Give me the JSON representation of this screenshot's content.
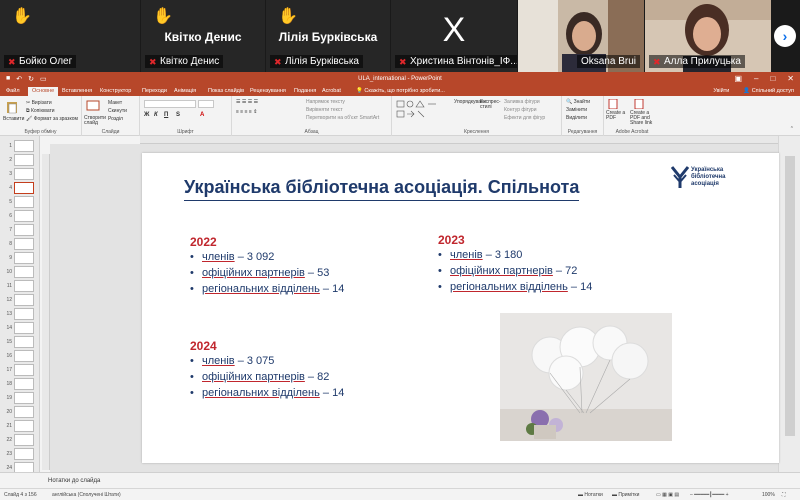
{
  "participants": [
    {
      "id": "boyko",
      "name": "Бойко Олег",
      "hand": true,
      "muted": true,
      "label": "Бойко Олег"
    },
    {
      "id": "kvitko",
      "name": "Квітко Денис",
      "hand": true,
      "muted": true,
      "label": "Квітко Денис"
    },
    {
      "id": "burkivska",
      "name": "Лілія Бурківська",
      "hand": true,
      "muted": true,
      "label": "Лілія Бурківська"
    },
    {
      "id": "vintoniv",
      "initial": "X",
      "muted": true,
      "label": "Христина Вінтонів_ІФ..."
    },
    {
      "id": "brui",
      "muted": false,
      "label": "Oksana Brui"
    },
    {
      "id": "prylutska",
      "muted": true,
      "label": "Алла Прилуцька"
    }
  ],
  "ppt": {
    "window_title": "ULA_international - PowerPoint",
    "tabs": [
      "Файл",
      "Основне",
      "Вставлення",
      "Конструктор",
      "Переходи",
      "Анімація",
      "Показ слайдів",
      "Рецензування",
      "Подання",
      "Acrobat"
    ],
    "active_tab": "Основне",
    "tell_me": "Скажіть, що потрібно зробити...",
    "account": "Увійти",
    "share": "Спільний доступ",
    "ribbon": {
      "clipboard": {
        "name": "Буфер обміну",
        "paste": "Вставити",
        "cut": "Вирізати",
        "copy": "Копіювати",
        "format": "Формат за зразком"
      },
      "slides": {
        "name": "Слайди",
        "new": "Створити слайд",
        "layout": "Макет",
        "reset": "Скинути",
        "section": "Розділ"
      },
      "font": {
        "name": "Шрифт"
      },
      "paragraph": {
        "name": "Абзац",
        "dir": "Напрямок тексту",
        "align": "Вирівняти текст",
        "smart": "Перетворити на об'єкт SmartArt"
      },
      "drawing": {
        "name": "Креслення",
        "arrange": "Упорядкувати",
        "styles": "Експрес-стилі",
        "fill": "Заливка фігури",
        "outline": "Контур фігури",
        "effects": "Ефекти для фігур"
      },
      "editing": {
        "name": "Редагування",
        "find": "Знайти",
        "replace": "Замінити",
        "select": "Виділити"
      },
      "acrobat": {
        "name": "Adobe Acrobat",
        "create": "Create a PDF",
        "share": "Create a PDF and Share link"
      }
    },
    "slide_numbers": [
      "1",
      "2",
      "3",
      "4",
      "5",
      "6",
      "7",
      "8",
      "9",
      "10",
      "11",
      "12",
      "13",
      "14",
      "15",
      "16",
      "17",
      "18",
      "19",
      "20",
      "21",
      "22",
      "23",
      "24"
    ],
    "active_slide": "4",
    "notes_placeholder": "Нотатки до слайда",
    "status": {
      "slide": "Слайд 4 з 156",
      "language": "англійська (Сполучені Штати)",
      "notes": "Нотатки",
      "comments": "Примітки",
      "zoom": "100%"
    }
  },
  "slide": {
    "title": "Українська бібліотечна асоціація. Спільнота",
    "logo_text": [
      "Українська",
      "бібліотечна",
      "асоціація"
    ],
    "blocks": [
      {
        "year": "2022",
        "items": [
          {
            "u": "членів",
            "rest": " – 3 092"
          },
          {
            "u": "офіційних партнерів",
            "rest": " – 53"
          },
          {
            "u": "регіональних відділень",
            "rest": " – 14"
          }
        ]
      },
      {
        "year": "2023",
        "items": [
          {
            "u": "членів",
            "rest": " – 3 180"
          },
          {
            "u": "офіційних партнерів",
            "rest": " – 72"
          },
          {
            "u": "регіональних відділень",
            "rest": " – 14"
          }
        ]
      },
      {
        "year": "2024",
        "items": [
          {
            "u": "членів",
            "rest": " – 3 075"
          },
          {
            "u": "офіційних партнерів",
            "rest": " –  82"
          },
          {
            "u": "регіональних відділень",
            "rest": " – 14"
          }
        ]
      }
    ]
  },
  "colors": {
    "ppt_brand": "#b7472a",
    "slide_title": "#1f3a6b",
    "year_red": "#c0262d",
    "hand_yellow": "#f6c343"
  }
}
